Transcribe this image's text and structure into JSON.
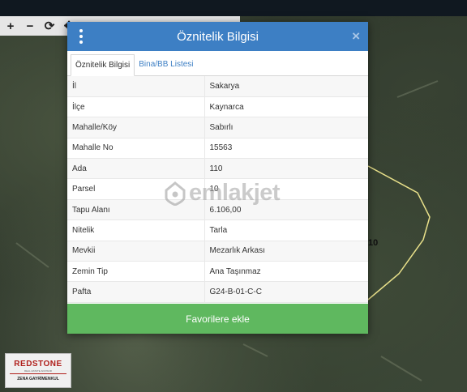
{
  "toolbar": {
    "zoom_in": "+",
    "zoom_out": "−",
    "refresh": "⟳",
    "pan": "✥"
  },
  "dialog": {
    "title": "Öznitelik Bilgisi",
    "close": "×",
    "tabs": [
      {
        "label": "Öznitelik Bilgisi",
        "active": true
      },
      {
        "label": "Bina/BB Listesi",
        "active": false
      }
    ],
    "rows": [
      {
        "key": "İl",
        "value": "Sakarya"
      },
      {
        "key": "İlçe",
        "value": "Kaynarca"
      },
      {
        "key": "Mahalle/Köy",
        "value": "Sabırlı"
      },
      {
        "key": "Mahalle No",
        "value": "15563"
      },
      {
        "key": "Ada",
        "value": "110"
      },
      {
        "key": "Parsel",
        "value": "10"
      },
      {
        "key": "Tapu Alanı",
        "value": "6.106,00"
      },
      {
        "key": "Nitelik",
        "value": "Tarla"
      },
      {
        "key": "Mevkii",
        "value": "Mezarlık Arkası"
      },
      {
        "key": "Zemin Tip",
        "value": "Ana Taşınmaz"
      },
      {
        "key": "Pafta",
        "value": "G24-B-01-C-C"
      }
    ],
    "favorite_button": "Favorilere ekle"
  },
  "map": {
    "parcel_label": "10"
  },
  "watermark": {
    "text": "emlakjet"
  },
  "logo": {
    "brand": "REDSTONE",
    "subtitle": "REAL ESTATE ADVISOR",
    "name": "ZENA GAYRİMENKUL"
  },
  "colors": {
    "header": "#3d7fc4",
    "button": "#5fb85f",
    "parcel_outline": "#e8e08a"
  },
  "icons": {
    "menu": "vertical-dots-icon",
    "close": "close-icon",
    "watermark": "house-pin-icon"
  }
}
